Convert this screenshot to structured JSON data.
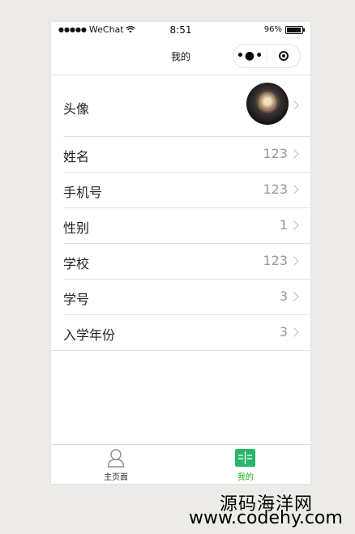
{
  "status_bar": {
    "signal_dots": "●●●●●",
    "carrier": "WeChat",
    "wifi_icon": "wifi-icon",
    "time": "8:51",
    "battery_percent": "96%",
    "battery_level": 0.96
  },
  "navbar": {
    "title": "我的",
    "more_icon": "more-dots-icon",
    "close_icon": "target-close-icon"
  },
  "profile": {
    "avatar_label": "头像",
    "rows": [
      {
        "label": "姓名",
        "value": "123"
      },
      {
        "label": "手机号",
        "value": "123"
      },
      {
        "label": "性别",
        "value": "1"
      },
      {
        "label": "学校",
        "value": "123"
      },
      {
        "label": "学号",
        "value": "3"
      },
      {
        "label": "入学年份",
        "value": "3"
      }
    ]
  },
  "tabbar": {
    "items": [
      {
        "label": "主页面",
        "icon": "person-icon",
        "active": false
      },
      {
        "label": "我的",
        "icon": "book-icon",
        "active": true
      }
    ],
    "active_color": "#1aad19",
    "inactive_color": "#333333"
  },
  "watermark": {
    "line1": "源码海洋网",
    "line2": "www.codehy.com"
  }
}
